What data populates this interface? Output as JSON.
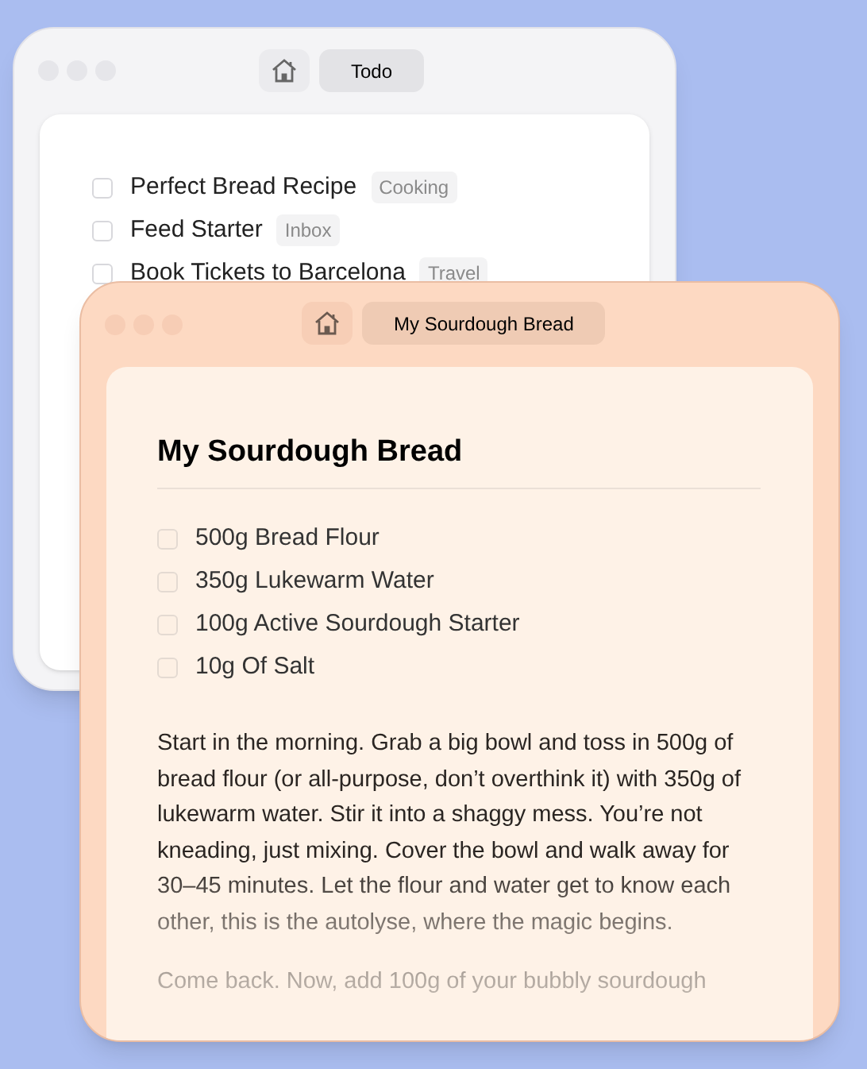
{
  "back_window": {
    "tab": "Todo",
    "todos": [
      {
        "title": "Perfect Bread Recipe",
        "tag": "Cooking",
        "checked": false
      },
      {
        "title": "Feed Starter",
        "tag": "Inbox",
        "checked": false
      },
      {
        "title": "Book Tickets to Barcelona",
        "tag": "Travel",
        "checked": false
      }
    ]
  },
  "front_window": {
    "tab": "My Sourdough Bread",
    "title": "My Sourdough Bread",
    "ingredients": [
      {
        "label": "500g Bread Flour",
        "checked": false
      },
      {
        "label": "350g Lukewarm Water",
        "checked": false
      },
      {
        "label": "100g Active Sourdough Starter",
        "checked": false
      },
      {
        "label": "10g Of Salt",
        "checked": false
      }
    ],
    "paragraphs": [
      "Start in the morning. Grab a big bowl and toss in 500g of bread flour (or all-purpose, don’t overthink it) with 350g of lukewarm water. Stir it into a shaggy mess. You’re not kneading, just mixing. Cover the bowl and walk away for 30–45 minutes. Let the flour and water get to know each other, this is the autolyse, where the magic begins.",
      "Come back. Now, add 100g of your bubbly sourdough"
    ]
  }
}
